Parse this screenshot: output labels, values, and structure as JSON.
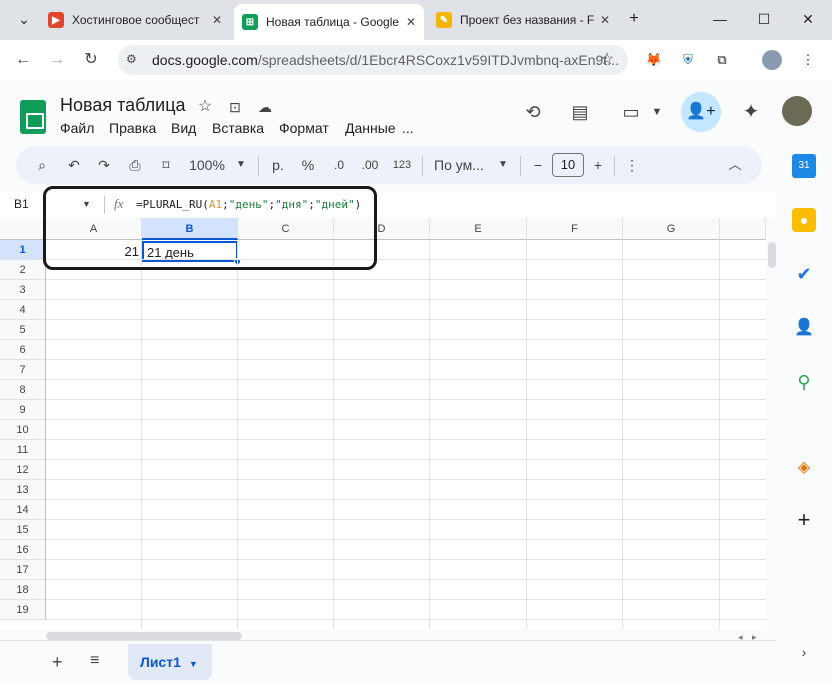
{
  "browser": {
    "tabs": [
      {
        "title": "Хостинговое сообщест",
        "active": false,
        "favicon_color": "#e0462d",
        "favicon": "▶"
      },
      {
        "title": "Новая таблица - Google",
        "active": true,
        "favicon_color": "#0f9d58",
        "favicon": "⊞"
      },
      {
        "title": "Проект без названия - F",
        "active": false,
        "favicon_color": "#f5b400",
        "favicon": "✎"
      }
    ],
    "new_tab": "+",
    "url_main": "docs.google.com",
    "url_rest": "/spreadsheets/d/1Ebcr4RSCoxz1v59ITDJvmbnq-axEn9t..."
  },
  "doc": {
    "title": "Новая таблица",
    "menu": [
      "Файл",
      "Правка",
      "Вид",
      "Вставка",
      "Формат",
      "Данные",
      "..."
    ]
  },
  "toolbar": {
    "zoom": "100%",
    "currency": "р.",
    "percent": "%",
    "dec_minus": ".0",
    "dec_plus": ".00",
    "num_format": "123",
    "font": "По ум...",
    "font_size": "10"
  },
  "formula_bar": {
    "cell_ref": "B1",
    "fx": "fx",
    "formula": "=PLURAL_RU(A1;\"день\";\"дня\";\"дней\")"
  },
  "grid": {
    "columns": [
      "A",
      "B",
      "C",
      "D",
      "E",
      "F",
      "G"
    ],
    "rows": [
      "1",
      "2",
      "3",
      "4",
      "5",
      "6",
      "7",
      "8",
      "9",
      "10",
      "11",
      "12",
      "13",
      "14",
      "15",
      "16",
      "17",
      "18",
      "19"
    ],
    "cells": {
      "A1": "21",
      "B1": "21 день"
    },
    "selected": "B1"
  },
  "sheets": {
    "active": "Лист1"
  },
  "colors": {
    "accent": "#0b57d0",
    "selection_header": "#d3e3fd",
    "sheets_green": "#0f9d58"
  }
}
